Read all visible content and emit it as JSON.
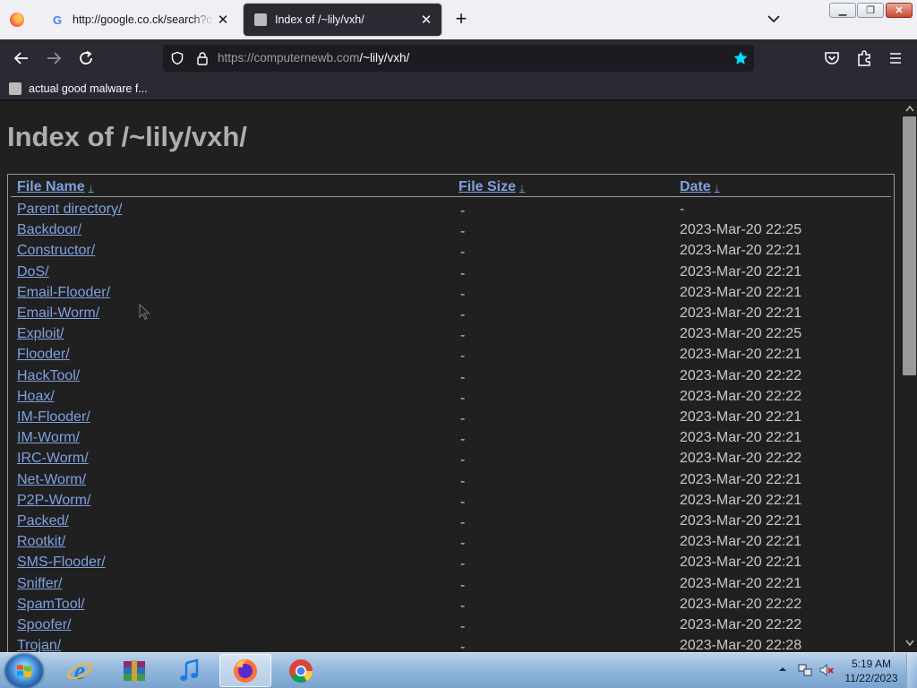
{
  "browser": {
    "tabs": [
      {
        "title": "http://google.co.ck/search?q=h",
        "favicon": "google-icon",
        "active": false
      },
      {
        "title": "Index of /~lily/vxh/",
        "favicon": "page-icon",
        "active": true
      }
    ],
    "url": {
      "host": "https://computernewb.com",
      "path": "/~lily/vxh/"
    },
    "bookmark": "actual good malware f...",
    "accent_star": "#00ddff"
  },
  "page": {
    "title": "Index of /~lily/vxh/",
    "columns": {
      "name": "File Name",
      "size": "File Size",
      "date": "Date",
      "sort_arrow": "↓"
    },
    "rows": [
      {
        "name": "Parent directory/",
        "size": "-",
        "date": "-"
      },
      {
        "name": "Backdoor/",
        "size": "-",
        "date": "2023-Mar-20 22:25"
      },
      {
        "name": "Constructor/",
        "size": "-",
        "date": "2023-Mar-20 22:21"
      },
      {
        "name": "DoS/",
        "size": "-",
        "date": "2023-Mar-20 22:21"
      },
      {
        "name": "Email-Flooder/",
        "size": "-",
        "date": "2023-Mar-20 22:21"
      },
      {
        "name": "Email-Worm/",
        "size": "-",
        "date": "2023-Mar-20 22:21"
      },
      {
        "name": "Exploit/",
        "size": "-",
        "date": "2023-Mar-20 22:25"
      },
      {
        "name": "Flooder/",
        "size": "-",
        "date": "2023-Mar-20 22:21"
      },
      {
        "name": "HackTool/",
        "size": "-",
        "date": "2023-Mar-20 22:22"
      },
      {
        "name": "Hoax/",
        "size": "-",
        "date": "2023-Mar-20 22:22"
      },
      {
        "name": "IM-Flooder/",
        "size": "-",
        "date": "2023-Mar-20 22:21"
      },
      {
        "name": "IM-Worm/",
        "size": "-",
        "date": "2023-Mar-20 22:21"
      },
      {
        "name": "IRC-Worm/",
        "size": "-",
        "date": "2023-Mar-20 22:22"
      },
      {
        "name": "Net-Worm/",
        "size": "-",
        "date": "2023-Mar-20 22:21"
      },
      {
        "name": "P2P-Worm/",
        "size": "-",
        "date": "2023-Mar-20 22:21"
      },
      {
        "name": "Packed/",
        "size": "-",
        "date": "2023-Mar-20 22:21"
      },
      {
        "name": "Rootkit/",
        "size": "-",
        "date": "2023-Mar-20 22:21"
      },
      {
        "name": "SMS-Flooder/",
        "size": "-",
        "date": "2023-Mar-20 22:21"
      },
      {
        "name": "Sniffer/",
        "size": "-",
        "date": "2023-Mar-20 22:21"
      },
      {
        "name": "SpamTool/",
        "size": "-",
        "date": "2023-Mar-20 22:22"
      },
      {
        "name": "Spoofer/",
        "size": "-",
        "date": "2023-Mar-20 22:22"
      },
      {
        "name": "Trojan/",
        "size": "-",
        "date": "2023-Mar-20 22:28"
      }
    ]
  },
  "taskbar": {
    "apps": [
      "internet-explorer-icon",
      "winrar-icon",
      "itunes-icon",
      "firefox-icon",
      "chrome-icon"
    ],
    "time": "5:19 AM",
    "date": "11/22/2023"
  }
}
